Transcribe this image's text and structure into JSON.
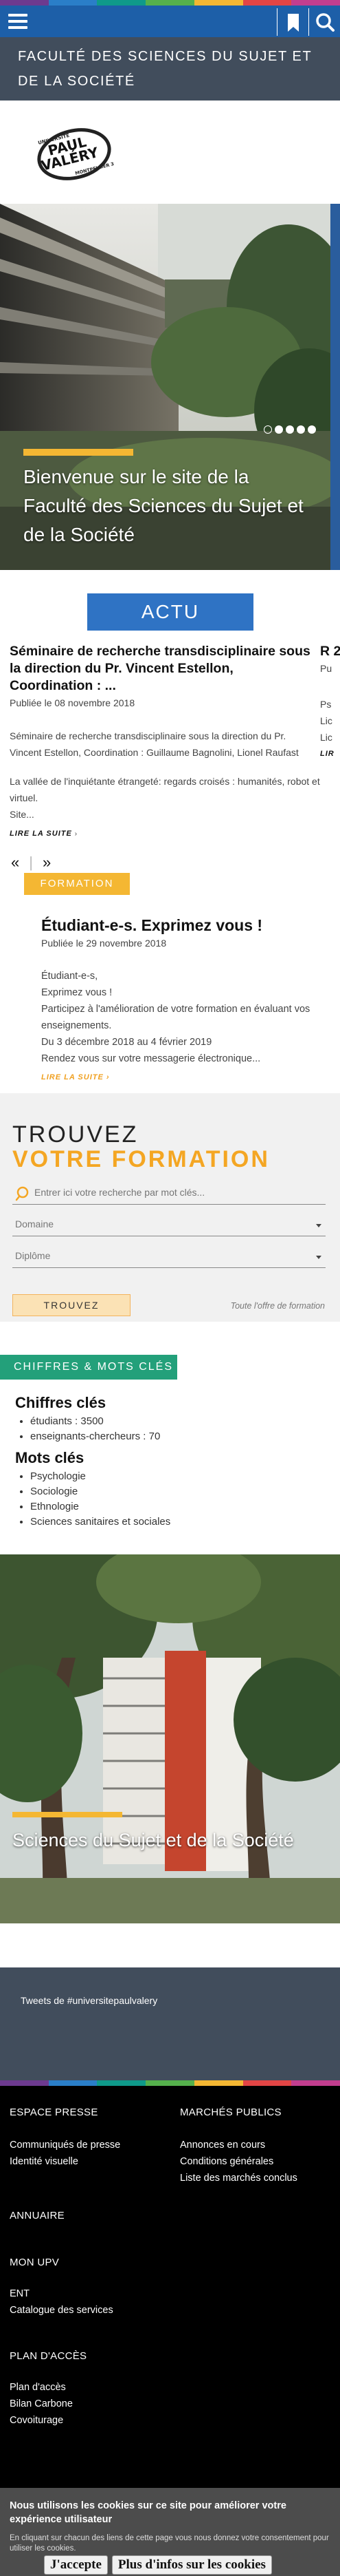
{
  "colors": {
    "brand_blue": "#1d5fa8",
    "title_bar": "#414d5c",
    "accent_yellow": "#f4b733",
    "actu_blue": "#2f73c4",
    "green": "#23a07a",
    "stripe": [
      "#6d3a8f",
      "#2a7ec8",
      "#0f9a8a",
      "#55b14c",
      "#f4b733",
      "#e24545",
      "#c23e8f"
    ]
  },
  "header": {
    "menu_icon": "hamburger-icon",
    "bookmark_icon": "bookmark-icon",
    "search_icon": "search-icon",
    "faculty_title": "Faculté des sciences du sujet et de la société"
  },
  "logo": {
    "line1": "UNIVERSITÉ",
    "line2": "PAUL",
    "line3": "VALÉRY",
    "line4": "MONTPELLIER 3"
  },
  "hero": {
    "caption": "Bienvenue sur le site de la Faculté des Sciences du Sujet et de la Société",
    "slides": 5,
    "active_slide": 0
  },
  "actu": {
    "button_label": "ACTU",
    "news": [
      {
        "title": "Séminaire de recherche transdisciplinaire sous la direction du Pr. Vincent Estellon, Coordination : ...",
        "date": "Publiée le 08 novembre 2018",
        "para1": "Séminaire de recherche transdisciplinaire sous la direction du Pr. Vincent Estellon, Coordination : Guillaume Bagnolini, Lionel Raufast",
        "para2": "La vallée de l'inquiétante étrangeté: regards croisés : humanités, robot et virtuel.",
        "para3": "Site...",
        "more": "Lire la suite"
      }
    ],
    "peek": {
      "title": "R 2",
      "date": "Pu",
      "lines": [
        "Ps",
        "Lic",
        "Lic"
      ],
      "more": "LIR"
    },
    "prev": "«",
    "next": "»"
  },
  "formation": {
    "tag": "FORMATION",
    "title": "Étudiant-e-s. Exprimez vous !",
    "date": "Publiée le 29 novembre 2018",
    "lines": [
      "Étudiant-e-s,",
      "Exprimez vous !",
      "Participez à l'amélioration de votre formation en évaluant vos enseignements.",
      "Du 3 décembre 2018 au 4 février 2019",
      "Rendez vous sur votre messagerie électronique..."
    ],
    "more": "Lire la suite"
  },
  "trouvez": {
    "title1": "TROUVEZ",
    "title2": "VOTRE FORMATION",
    "search_placeholder": "Entrer ici votre recherche par mot clés...",
    "domaine": "Domaine",
    "diplome": "Diplôme",
    "button": "TROUVEZ",
    "offer_link": "Toute l'offre de formation"
  },
  "chiffres": {
    "tag": "CHIFFRES & MOTS CLÉS",
    "heading1": "Chiffres clés",
    "stats": [
      "étudiants : 3500",
      "enseignants-chercheurs : 70"
    ],
    "heading2": "Mots clés",
    "keywords": [
      "Psychologie",
      "Sociologie",
      "Ethnologie",
      "Sciences sanitaires et sociales"
    ]
  },
  "building": {
    "caption": "Sciences du Sujet et de la Société"
  },
  "tweets": {
    "label": "Tweets de #universitepaulvalery"
  },
  "footer": {
    "espace_presse": "ESPACE PRESSE",
    "presse_links": [
      "Communiqués de presse",
      "Identité visuelle"
    ],
    "marches": "MARCHÉS PUBLICS",
    "marches_links": [
      "Annonces en cours",
      "Conditions générales",
      "Liste des marchés conclus"
    ],
    "annuaire": "ANNUAIRE",
    "mon_upv": "MON UPV",
    "ent_links": [
      "ENT",
      "Catalogue des services"
    ],
    "plan_acces": "PLAN D'ACCÈS",
    "plan_links": [
      "Plan d'accès",
      "Bilan Carbone",
      "Covoiturage"
    ]
  },
  "cookie": {
    "title": "Nous utilisons les cookies sur ce site pour améliorer votre expérience utilisateur",
    "subtitle": "En cliquant sur chacun des liens de cette page vous nous donnez votre consentement pour utiliser les cookies.",
    "accept": "J'accepte",
    "info": "Plus d'infos sur les cookies"
  }
}
